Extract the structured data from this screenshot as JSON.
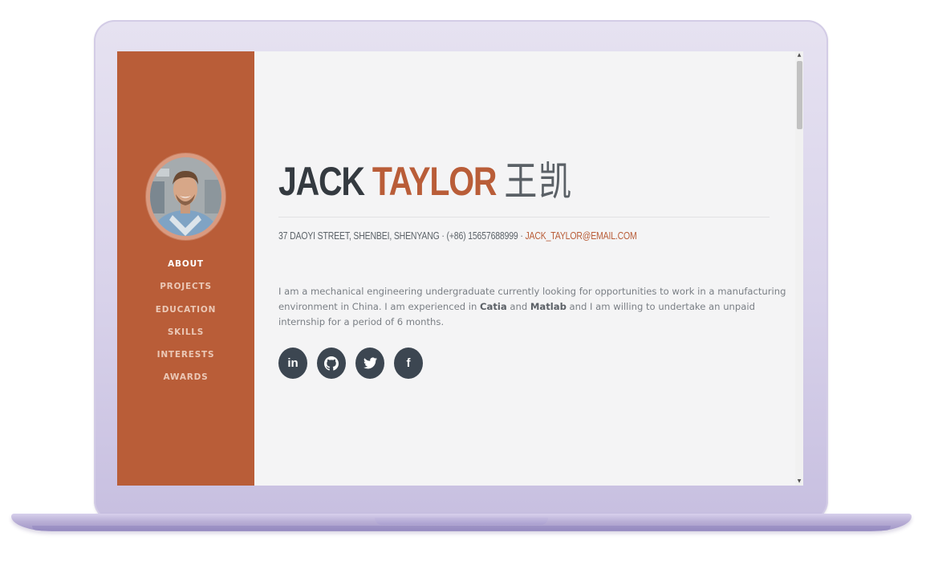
{
  "profile": {
    "first_name": "JACK",
    "last_name": "TAYLOR",
    "chinese_name": "王凯",
    "address": "37 DAOYI STREET, SHENBEI, SHENYANG",
    "separator": "·",
    "phone": "(+86) 15657688999",
    "email": "JACK_TAYLOR@EMAIL.COM"
  },
  "bio": {
    "part1": "I am a mechanical engineering undergraduate currently looking for opportunities to work in a manufacturing environment in China. I am experienced in ",
    "skill1": "Catia",
    "part2": " and ",
    "skill2": "Matlab",
    "part3": " and I am willing to undertake an unpaid internship for a period of 6 months."
  },
  "nav": {
    "items": [
      "ABOUT",
      "PROJECTS",
      "EDUCATION",
      "SKILLS",
      "INTERESTS",
      "AWARDS"
    ]
  },
  "socials": [
    {
      "icon": "linkedin-icon",
      "glyph": "in"
    },
    {
      "icon": "github-icon",
      "glyph": "◉"
    },
    {
      "icon": "twitter-icon",
      "glyph": ""
    },
    {
      "icon": "facebook-icon",
      "glyph": "f"
    }
  ],
  "colors": {
    "accent": "#b95d38",
    "dark": "#343a40",
    "social_bg": "#3c4651",
    "background": "#f4f4f5"
  }
}
